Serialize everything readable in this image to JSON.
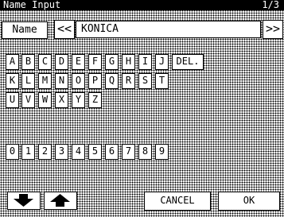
{
  "title": {
    "text": "Name Input",
    "page": "1/3"
  },
  "field": {
    "label": "Name",
    "value": "KONICA"
  },
  "nav": {
    "prev": "<<",
    "next": ">>"
  },
  "keys": {
    "row1": [
      "A",
      "B",
      "C",
      "D",
      "E",
      "F",
      "G",
      "H",
      "I",
      "J"
    ],
    "row2": [
      "K",
      "L",
      "M",
      "N",
      "O",
      "P",
      "Q",
      "R",
      "S",
      "T"
    ],
    "row3": [
      "U",
      "V",
      "W",
      "X",
      "Y",
      "Z"
    ],
    "digits": [
      "0",
      "1",
      "2",
      "3",
      "4",
      "5",
      "6",
      "7",
      "8",
      "9"
    ],
    "delete": "DEL."
  },
  "buttons": {
    "cancel": "CANCEL",
    "ok": "OK"
  },
  "icons": {
    "down": "down-arrow-icon",
    "up": "up-arrow-icon"
  }
}
